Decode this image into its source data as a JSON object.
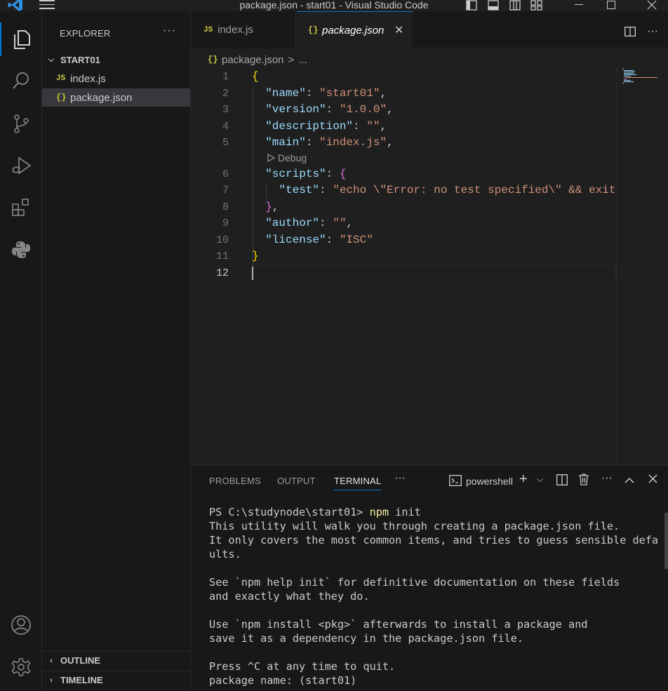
{
  "window": {
    "title": "package.json - start01 - Visual Studio Code"
  },
  "sidebar": {
    "title": "EXPLORER",
    "more": "···",
    "folder": "START01",
    "files": [
      {
        "badge": "JS",
        "name": "index.js",
        "selected": false
      },
      {
        "badge": "{}",
        "name": "package.json",
        "selected": true
      }
    ],
    "sections": [
      "OUTLINE",
      "TIMELINE"
    ]
  },
  "tabs": [
    {
      "badge": "JS",
      "label": "index.js",
      "active": false
    },
    {
      "badge": "{}",
      "label": "package.json",
      "active": true,
      "close": "✕"
    }
  ],
  "breadcrumb": {
    "badge": "{}",
    "file": "package.json",
    "sep": ">",
    "rest": "..."
  },
  "editor": {
    "line_numbers": [
      "1",
      "2",
      "3",
      "4",
      "5",
      "6",
      "7",
      "8",
      "9",
      "10",
      "11",
      "12"
    ],
    "current_line": "12",
    "codelens": "Debug",
    "code": {
      "name_key": "\"name\"",
      "name_val": "\"start01\"",
      "version_key": "\"version\"",
      "version_val": "\"1.0.0\"",
      "description_key": "\"description\"",
      "description_val": "\"\"",
      "main_key": "\"main\"",
      "main_val": "\"index.js\"",
      "scripts_key": "\"scripts\"",
      "test_key": "\"test\"",
      "test_val": "\"echo \\\"Error: no test specified\\\" && exit",
      "author_key": "\"author\"",
      "author_val": "\"\"",
      "license_key": "\"license\"",
      "license_val": "\"ISC\""
    }
  },
  "panel": {
    "tabs": [
      "PROBLEMS",
      "OUTPUT",
      "TERMINAL"
    ],
    "active_tab": "TERMINAL",
    "more": "···",
    "shell": "powershell",
    "terminal": {
      "prompt": "PS C:\\studynode\\start01> ",
      "command": "npm",
      "command_args": " init",
      "lines": [
        "This utility will walk you through creating a package.json file.",
        "It only covers the most common items, and tries to guess sensible defa",
        "ults.",
        "",
        "See `npm help init` for definitive documentation on these fields",
        "and exactly what they do.",
        "",
        "Use `npm install <pkg>` afterwards to install a package and",
        "save it as a dependency in the package.json file.",
        "",
        "Press ^C at any time to quit.",
        "package name: (start01)"
      ]
    }
  },
  "colors": {
    "accent": "#0078d4",
    "json_badge": "#cbcb41",
    "string": "#ce9178",
    "key": "#9cdcfe"
  }
}
